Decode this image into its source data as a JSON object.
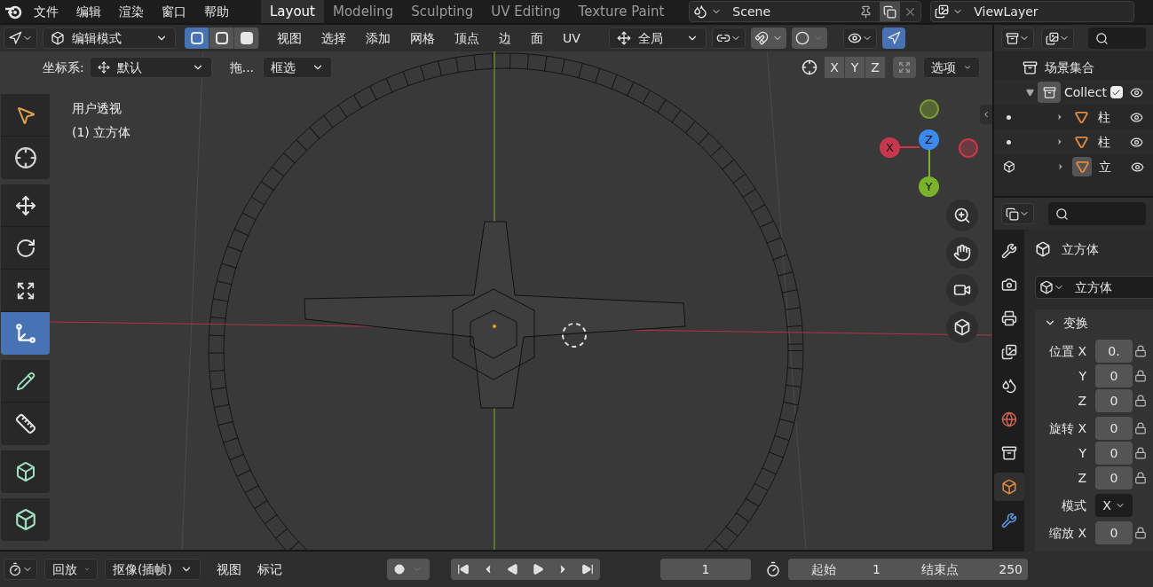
{
  "menu": [
    "文件",
    "编辑",
    "渲染",
    "窗口",
    "帮助"
  ],
  "workspace_tabs": [
    {
      "label": "Layout",
      "selected": true
    },
    {
      "label": "Modeling",
      "selected": false
    },
    {
      "label": "Sculpting",
      "selected": false
    },
    {
      "label": "UV Editing",
      "selected": false
    },
    {
      "label": "Texture Paint",
      "selected": false
    }
  ],
  "scene": {
    "name": "Scene"
  },
  "view_layer": {
    "name": "ViewLayer"
  },
  "viewport_header": {
    "mode": "编辑模式",
    "select_modes": [
      {
        "kind": "vertex",
        "selected": true
      },
      {
        "kind": "edge",
        "selected": false
      },
      {
        "kind": "face",
        "selected": false
      }
    ],
    "menus": [
      "视图",
      "选择",
      "添加",
      "网格",
      "顶点",
      "边",
      "面",
      "UV"
    ],
    "orientation": "全局",
    "xray_toggle": {
      "on": true
    }
  },
  "tool_settings": {
    "coordinate_label": "坐标系:",
    "coordinate_value": "默认",
    "drag_label": "拖...",
    "drag_value": "框选",
    "axes": [
      "X",
      "Y",
      "Z"
    ],
    "options": "选项"
  },
  "viewport_overlay": [
    "用户透视",
    "(1) 立方体"
  ],
  "tools": [
    {
      "kind": "select",
      "selected": false
    },
    {
      "kind": "cursor",
      "selected": false
    },
    {
      "kind": "move",
      "selected": false
    },
    {
      "kind": "rotate",
      "selected": false
    },
    {
      "kind": "scale",
      "selected": false
    },
    {
      "kind": "transform",
      "selected": true
    },
    {
      "kind": "annotate",
      "selected": false
    },
    {
      "kind": "measure",
      "selected": false
    },
    {
      "kind": "add-cube",
      "selected": false
    },
    {
      "kind": "extrude",
      "selected": false
    }
  ],
  "gizmo": {
    "x": "X",
    "y": "Y",
    "z": "Z"
  },
  "outliner": {
    "root": "场景集合",
    "collection": {
      "name": "Collect",
      "checked": true,
      "expanded": true,
      "children": [
        {
          "name": "柱",
          "selected": false,
          "expanded": false
        },
        {
          "name": "柱",
          "selected": false,
          "expanded": false
        },
        {
          "name": "立",
          "selected": true,
          "expanded": false
        }
      ]
    }
  },
  "properties": {
    "tabs": [
      {
        "kind": "tool",
        "selected": false
      },
      {
        "kind": "render",
        "selected": false
      },
      {
        "kind": "output",
        "selected": false
      },
      {
        "kind": "view-layer",
        "selected": false
      },
      {
        "kind": "scene",
        "selected": false
      },
      {
        "kind": "world",
        "selected": false
      },
      {
        "kind": "collection",
        "selected": false
      },
      {
        "kind": "object",
        "selected": true
      },
      {
        "kind": "modifier",
        "selected": false
      }
    ],
    "object_name": "立方体",
    "data_name": "立方体",
    "section": {
      "title": "变换",
      "expanded": true
    },
    "rows": [
      {
        "kind": "number",
        "label": "位置 X",
        "value": "0."
      },
      {
        "kind": "number",
        "label": "Y",
        "value": "0"
      },
      {
        "kind": "number",
        "label": "Z",
        "value": "0"
      },
      {
        "kind": "number",
        "label": "旋转 X",
        "value": "0"
      },
      {
        "kind": "number",
        "label": "Y",
        "value": "0"
      },
      {
        "kind": "number",
        "label": "Z",
        "value": "0"
      },
      {
        "kind": "dropdown",
        "label": "模式",
        "value": "X"
      },
      {
        "kind": "number",
        "label": "缩放 X",
        "value": "0"
      }
    ]
  },
  "timeline": {
    "playback": "回放",
    "keying": "抠像(插帧)",
    "menus": [
      "视图",
      "标记"
    ],
    "current_frame": "1",
    "start_label": "起始",
    "start": "1",
    "end_label": "结束点",
    "end": "250"
  }
}
